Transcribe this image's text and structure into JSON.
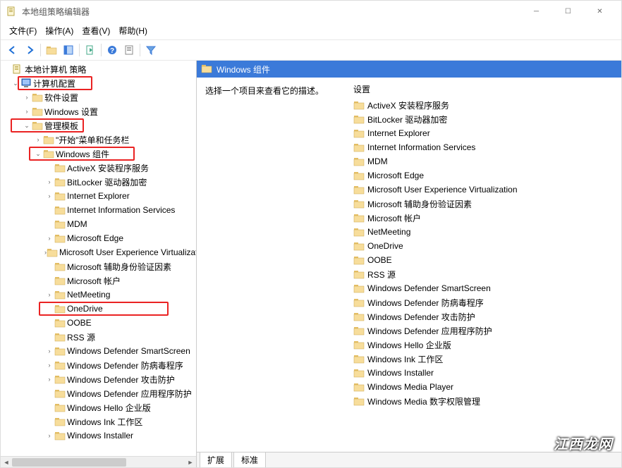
{
  "window": {
    "title": "本地组策略编辑器"
  },
  "menu": {
    "file": "文件(F)",
    "action": "操作(A)",
    "view": "查看(V)",
    "help": "帮助(H)"
  },
  "tree": {
    "root": "本地计算机 策略",
    "computer_config": "计算机配置",
    "software_settings": "软件设置",
    "windows_settings": "Windows 设置",
    "admin_templates": "管理模板",
    "start_menu_taskbar": "\"开始\"菜单和任务栏",
    "windows_components": "Windows 组件",
    "items": {
      "activex": "ActiveX 安装程序服务",
      "bitlocker": "BitLocker 驱动器加密",
      "ie": "Internet Explorer",
      "iis": "Internet Information Services",
      "mdm": "MDM",
      "edge": "Microsoft Edge",
      "uev": "Microsoft User Experience Virtualization",
      "secondary_auth": "Microsoft 辅助身份验证因素",
      "ms_account": "Microsoft 帐户",
      "netmeeting": "NetMeeting",
      "onedrive": "OneDrive",
      "oobe": "OOBE",
      "rss": "RSS 源",
      "smartscreen": "Windows Defender SmartScreen",
      "antivirus": "Windows Defender 防病毒程序",
      "exploit": "Windows Defender 攻击防护",
      "app_guard": "Windows Defender 应用程序防护",
      "hello": "Windows Hello 企业版",
      "ink": "Windows Ink 工作区",
      "installer": "Windows Installer",
      "media_player": "Windows Media Player",
      "drm": "Windows Media 数字权限管理"
    }
  },
  "right": {
    "header": "Windows 组件",
    "description": "选择一个项目来查看它的描述。",
    "settings_label": "设置"
  },
  "tabs": {
    "extended": "扩展",
    "standard": "标准"
  },
  "watermark": "江西龙网"
}
